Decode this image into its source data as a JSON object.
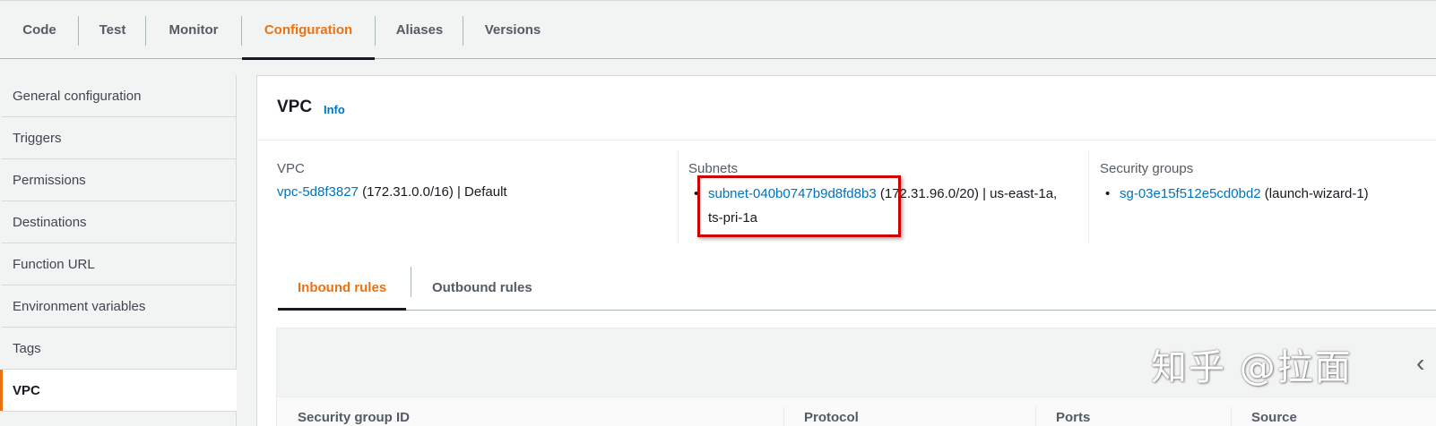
{
  "top_tabs": [
    "Code",
    "Test",
    "Monitor",
    "Configuration",
    "Aliases",
    "Versions"
  ],
  "side_nav": [
    "General configuration",
    "Triggers",
    "Permissions",
    "Destinations",
    "Function URL",
    "Environment variables",
    "Tags",
    "VPC"
  ],
  "panel": {
    "title": "VPC",
    "info": "Info",
    "vpc": {
      "label": "VPC",
      "link": "vpc-5d8f3827",
      "suffix": " (172.31.0.0/16) | Default"
    },
    "subnets": {
      "label": "Subnets",
      "link": "subnet-040b0747b9d8fd8b3",
      "suffix": " (172.31.96.0/20) | us-east-1a, ts-pri-1a"
    },
    "security_groups": {
      "label": "Security groups",
      "link": "sg-03e15f512e5cd0bd2",
      "suffix": " (launch-wizard-1)"
    }
  },
  "rules_tabs": [
    "Inbound rules",
    "Outbound rules"
  ],
  "table_headers": [
    "Security group ID",
    "Protocol",
    "Ports",
    "Source"
  ],
  "watermark": "知乎 @拉面",
  "colors": {
    "accent": "#ec7211",
    "link": "#0073bb",
    "highlight": "#d10000"
  },
  "icons": [
    "chevron-left-icon"
  ]
}
